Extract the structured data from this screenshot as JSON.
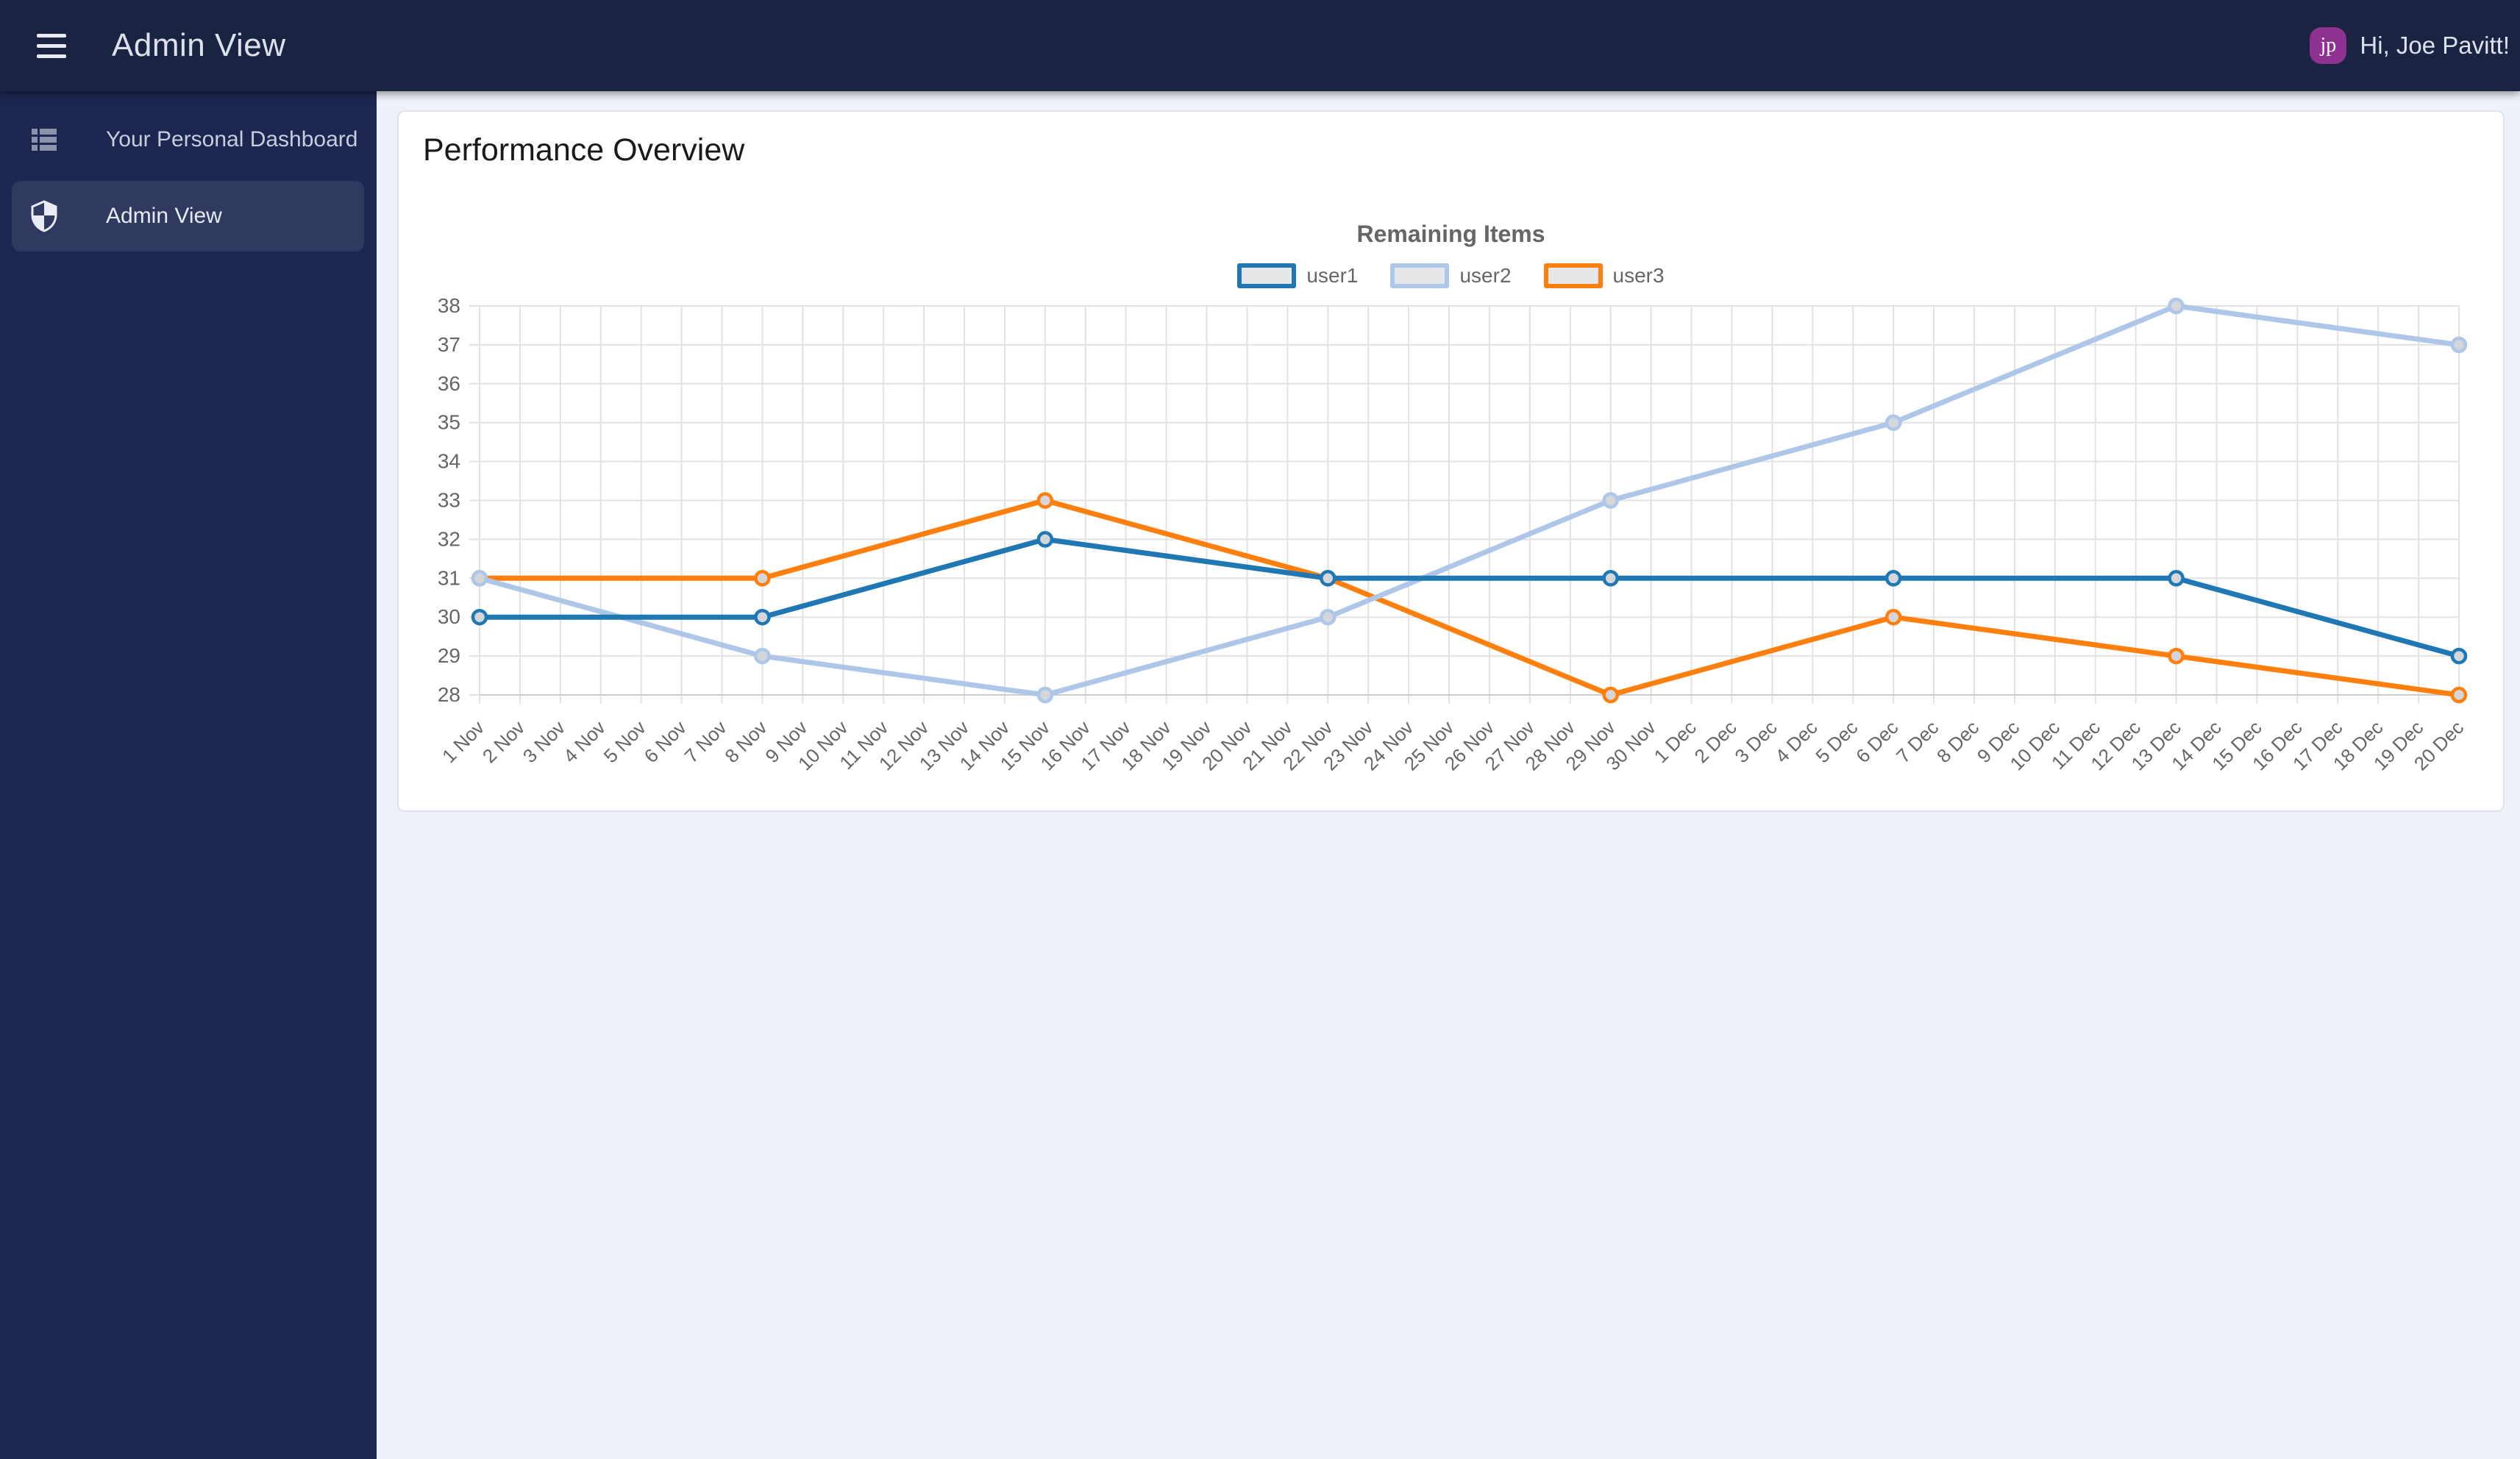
{
  "topbar": {
    "title": "Admin View",
    "greeting": "Hi, Joe Pavitt!",
    "avatar_initials": "jp",
    "background": "#1a2342",
    "avatar_color": "#8e3190",
    "menu_icon": "hamburger-menu-icon"
  },
  "sidebar": {
    "background": "#1c2650",
    "items": [
      {
        "label": "Your Personal Dashboard",
        "icon": "view-list-icon",
        "active": false
      },
      {
        "label": "Admin View",
        "icon": "shield-icon",
        "active": true
      }
    ]
  },
  "main": {
    "card_title": "Performance Overview"
  },
  "chart_data": {
    "type": "line",
    "title": "Remaining Items",
    "legend_position": "top",
    "grid": true,
    "ylim": [
      28,
      38
    ],
    "y_ticks": [
      28,
      29,
      30,
      31,
      32,
      33,
      34,
      35,
      36,
      37,
      38
    ],
    "x_labels": [
      "1 Nov",
      "2 Nov",
      "3 Nov",
      "4 Nov",
      "5 Nov",
      "6 Nov",
      "7 Nov",
      "8 Nov",
      "9 Nov",
      "10 Nov",
      "11 Nov",
      "12 Nov",
      "13 Nov",
      "14 Nov",
      "15 Nov",
      "16 Nov",
      "17 Nov",
      "18 Nov",
      "19 Nov",
      "20 Nov",
      "21 Nov",
      "22 Nov",
      "23 Nov",
      "24 Nov",
      "25 Nov",
      "26 Nov",
      "27 Nov",
      "28 Nov",
      "29 Nov",
      "30 Nov",
      "1 Dec",
      "2 Dec",
      "3 Dec",
      "4 Dec",
      "5 Dec",
      "6 Dec",
      "7 Dec",
      "8 Dec",
      "9 Dec",
      "10 Dec",
      "11 Dec",
      "12 Dec",
      "13 Dec",
      "14 Dec",
      "15 Dec",
      "16 Dec",
      "17 Dec",
      "18 Dec",
      "19 Dec",
      "20 Dec"
    ],
    "point_labels": [
      "1 Nov",
      "8 Nov",
      "15 Nov",
      "22 Nov",
      "29 Nov",
      "6 Dec",
      "13 Dec",
      "20 Dec"
    ],
    "point_indices": [
      0,
      7,
      14,
      21,
      28,
      35,
      42,
      49
    ],
    "series": [
      {
        "name": "user1",
        "color": "#1f77b4",
        "values": [
          30,
          30,
          32,
          31,
          31,
          31,
          31,
          29
        ]
      },
      {
        "name": "user2",
        "color": "#aec7e8",
        "values": [
          31,
          29,
          28,
          30,
          33,
          35,
          38,
          37
        ]
      },
      {
        "name": "user3",
        "color": "#ff7f0e",
        "values": [
          31,
          31,
          33,
          31,
          28,
          30,
          29,
          28
        ]
      }
    ],
    "text_color": "#666666",
    "grid_color": "#e2e2e2",
    "axis_color": "#c8cdd2",
    "marker_fill": "#d4d6da",
    "legend_swatch_fill": "#e6e7e9"
  }
}
